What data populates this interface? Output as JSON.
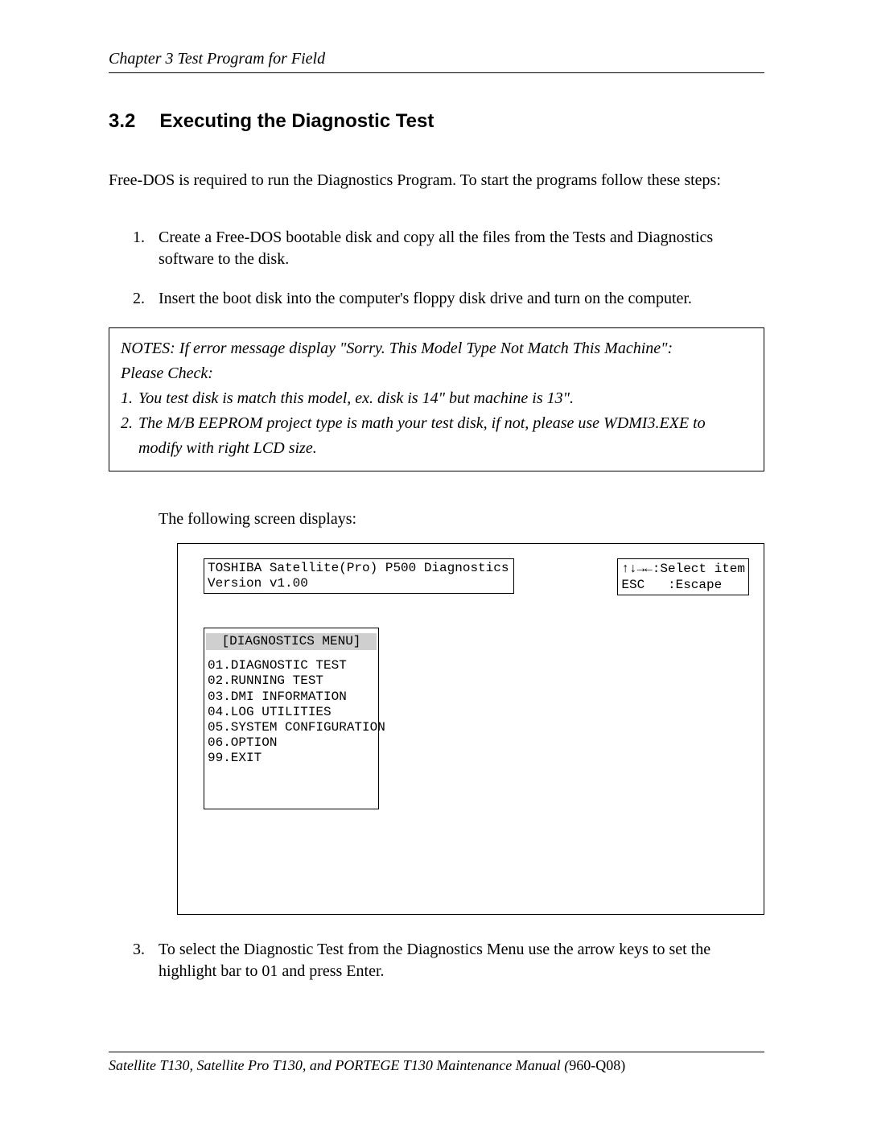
{
  "header": {
    "chapter": "Chapter 3 Test Program for Field"
  },
  "section": {
    "number": "3.2",
    "title": "Executing the Diagnostic Test"
  },
  "intro": "Free-DOS is required to run the Diagnostics Program. To start the programs follow these steps:",
  "steps": {
    "s1": "Create a Free-DOS bootable disk and copy all the files from the Tests and Diagnostics software to the disk.",
    "s2": "Insert the boot disk into the computer's floppy disk drive and turn on the computer.",
    "s3": "To select the Diagnostic Test from the Diagnostics Menu use the arrow keys to set the highlight bar to 01 and press Enter."
  },
  "notes": {
    "lead": "NOTES:  If error message display \"Sorry. This Model Type Not Match This Machine\":",
    "please": "Please Check:",
    "n1": "You test disk is match this model, ex. disk is 14\" but machine is 13\".",
    "n2": "The M/B EEPROM project type is math your test disk, if not, please use WDMI3.EXE to modify with right LCD size."
  },
  "screen_caption": "The following screen displays:",
  "screen": {
    "title_line1": "TOSHIBA Satellite(Pro) P500 Diagnostics",
    "title_line2": "Version v1.00",
    "hint_line1": "↑↓→←:Select item",
    "hint_line2": "ESC   :Escape",
    "menu_title": "[DIAGNOSTICS MENU]",
    "menu_items": "01.DIAGNOSTIC TEST\n02.RUNNING TEST\n03.DMI INFORMATION\n04.LOG UTILITIES\n05.SYSTEM CONFIGURATION\n06.OPTION\n99.EXIT"
  },
  "footer": {
    "italic": "Satellite T130, Satellite Pro T130, and PORTEGE T130 Maintenance Manual (",
    "rest": "960-Q08)"
  }
}
